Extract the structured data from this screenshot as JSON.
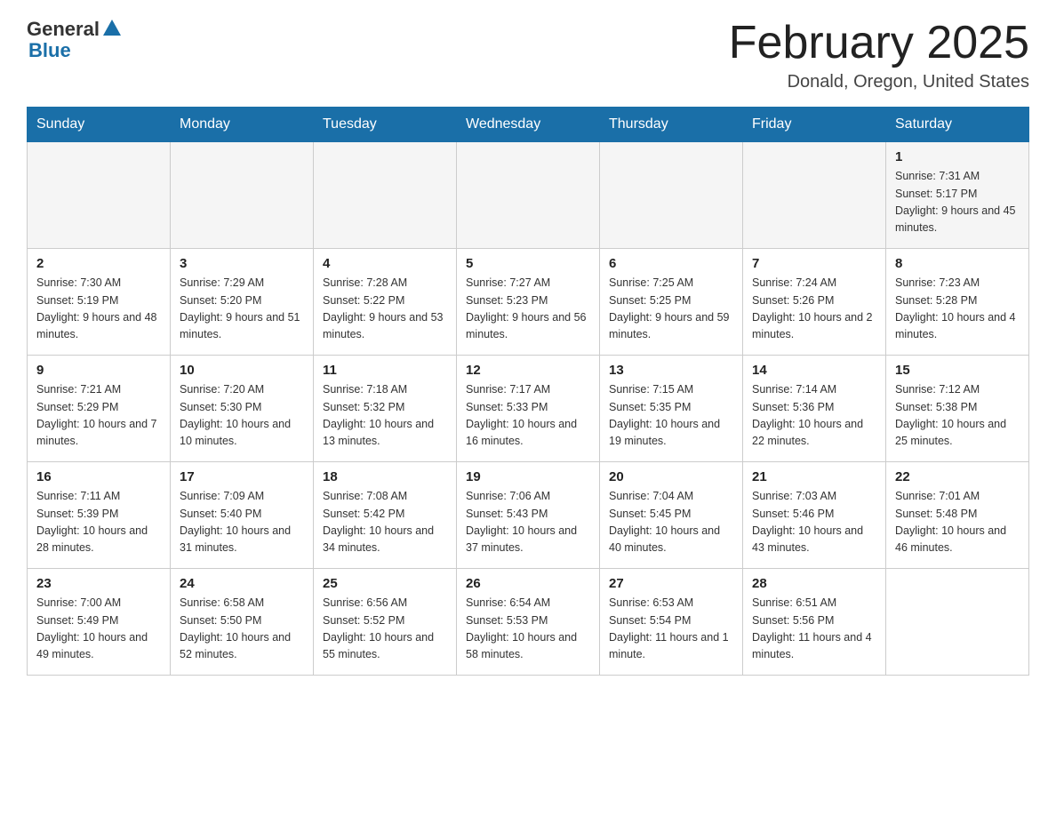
{
  "logo": {
    "general": "General",
    "blue": "Blue"
  },
  "title": {
    "month_year": "February 2025",
    "location": "Donald, Oregon, United States"
  },
  "days_of_week": [
    "Sunday",
    "Monday",
    "Tuesday",
    "Wednesday",
    "Thursday",
    "Friday",
    "Saturday"
  ],
  "weeks": [
    [
      {
        "day": "",
        "info": ""
      },
      {
        "day": "",
        "info": ""
      },
      {
        "day": "",
        "info": ""
      },
      {
        "day": "",
        "info": ""
      },
      {
        "day": "",
        "info": ""
      },
      {
        "day": "",
        "info": ""
      },
      {
        "day": "1",
        "info": "Sunrise: 7:31 AM\nSunset: 5:17 PM\nDaylight: 9 hours and 45 minutes."
      }
    ],
    [
      {
        "day": "2",
        "info": "Sunrise: 7:30 AM\nSunset: 5:19 PM\nDaylight: 9 hours and 48 minutes."
      },
      {
        "day": "3",
        "info": "Sunrise: 7:29 AM\nSunset: 5:20 PM\nDaylight: 9 hours and 51 minutes."
      },
      {
        "day": "4",
        "info": "Sunrise: 7:28 AM\nSunset: 5:22 PM\nDaylight: 9 hours and 53 minutes."
      },
      {
        "day": "5",
        "info": "Sunrise: 7:27 AM\nSunset: 5:23 PM\nDaylight: 9 hours and 56 minutes."
      },
      {
        "day": "6",
        "info": "Sunrise: 7:25 AM\nSunset: 5:25 PM\nDaylight: 9 hours and 59 minutes."
      },
      {
        "day": "7",
        "info": "Sunrise: 7:24 AM\nSunset: 5:26 PM\nDaylight: 10 hours and 2 minutes."
      },
      {
        "day": "8",
        "info": "Sunrise: 7:23 AM\nSunset: 5:28 PM\nDaylight: 10 hours and 4 minutes."
      }
    ],
    [
      {
        "day": "9",
        "info": "Sunrise: 7:21 AM\nSunset: 5:29 PM\nDaylight: 10 hours and 7 minutes."
      },
      {
        "day": "10",
        "info": "Sunrise: 7:20 AM\nSunset: 5:30 PM\nDaylight: 10 hours and 10 minutes."
      },
      {
        "day": "11",
        "info": "Sunrise: 7:18 AM\nSunset: 5:32 PM\nDaylight: 10 hours and 13 minutes."
      },
      {
        "day": "12",
        "info": "Sunrise: 7:17 AM\nSunset: 5:33 PM\nDaylight: 10 hours and 16 minutes."
      },
      {
        "day": "13",
        "info": "Sunrise: 7:15 AM\nSunset: 5:35 PM\nDaylight: 10 hours and 19 minutes."
      },
      {
        "day": "14",
        "info": "Sunrise: 7:14 AM\nSunset: 5:36 PM\nDaylight: 10 hours and 22 minutes."
      },
      {
        "day": "15",
        "info": "Sunrise: 7:12 AM\nSunset: 5:38 PM\nDaylight: 10 hours and 25 minutes."
      }
    ],
    [
      {
        "day": "16",
        "info": "Sunrise: 7:11 AM\nSunset: 5:39 PM\nDaylight: 10 hours and 28 minutes."
      },
      {
        "day": "17",
        "info": "Sunrise: 7:09 AM\nSunset: 5:40 PM\nDaylight: 10 hours and 31 minutes."
      },
      {
        "day": "18",
        "info": "Sunrise: 7:08 AM\nSunset: 5:42 PM\nDaylight: 10 hours and 34 minutes."
      },
      {
        "day": "19",
        "info": "Sunrise: 7:06 AM\nSunset: 5:43 PM\nDaylight: 10 hours and 37 minutes."
      },
      {
        "day": "20",
        "info": "Sunrise: 7:04 AM\nSunset: 5:45 PM\nDaylight: 10 hours and 40 minutes."
      },
      {
        "day": "21",
        "info": "Sunrise: 7:03 AM\nSunset: 5:46 PM\nDaylight: 10 hours and 43 minutes."
      },
      {
        "day": "22",
        "info": "Sunrise: 7:01 AM\nSunset: 5:48 PM\nDaylight: 10 hours and 46 minutes."
      }
    ],
    [
      {
        "day": "23",
        "info": "Sunrise: 7:00 AM\nSunset: 5:49 PM\nDaylight: 10 hours and 49 minutes."
      },
      {
        "day": "24",
        "info": "Sunrise: 6:58 AM\nSunset: 5:50 PM\nDaylight: 10 hours and 52 minutes."
      },
      {
        "day": "25",
        "info": "Sunrise: 6:56 AM\nSunset: 5:52 PM\nDaylight: 10 hours and 55 minutes."
      },
      {
        "day": "26",
        "info": "Sunrise: 6:54 AM\nSunset: 5:53 PM\nDaylight: 10 hours and 58 minutes."
      },
      {
        "day": "27",
        "info": "Sunrise: 6:53 AM\nSunset: 5:54 PM\nDaylight: 11 hours and 1 minute."
      },
      {
        "day": "28",
        "info": "Sunrise: 6:51 AM\nSunset: 5:56 PM\nDaylight: 11 hours and 4 minutes."
      },
      {
        "day": "",
        "info": ""
      }
    ]
  ]
}
